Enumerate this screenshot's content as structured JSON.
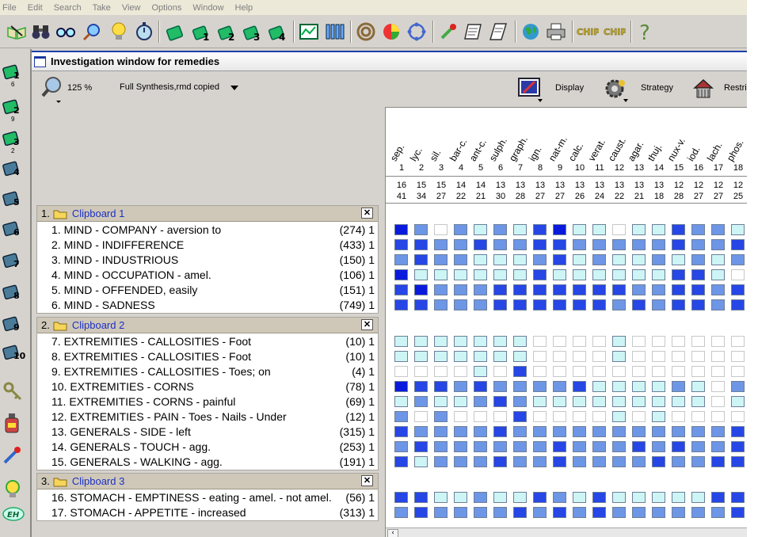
{
  "menu": [
    "File",
    "Edit",
    "Search",
    "Take",
    "View",
    "Options",
    "Window",
    "Help"
  ],
  "window_title": "Investigation window for remedies",
  "zoom": "125 %",
  "document": "Full Synthesis,rmd copied",
  "buttons": {
    "display": "Display",
    "strategy": "Strategy",
    "restrict": "Restri"
  },
  "toolbar_icons": [
    "open-book-icon",
    "binoculars-icon",
    "glasses-icon",
    "magnifier-icon",
    "lightbulb-icon",
    "stopwatch-icon",
    "clipboard-icon",
    "clipboard-1-icon",
    "clipboard-2-icon",
    "clipboard-3-icon",
    "clipboard-4-icon",
    "chart-icon",
    "test-tubes-icon",
    "target-icon",
    "pie-chart-icon",
    "cycle-icon",
    "pipette-icon",
    "scroll-icon",
    "scroll-2-icon",
    "globe-icon",
    "printer-icon",
    "chip-icon",
    "chip-2-icon",
    "help-icon"
  ],
  "toolbar_text": {
    "chip1": "CHIP",
    "chip2": "CHIP",
    "help": "?"
  },
  "sidebar": [
    {
      "label": "1",
      "count": "6"
    },
    {
      "label": "2",
      "count": "9"
    },
    {
      "label": "3",
      "count": "2"
    },
    {
      "label": "4",
      "count": ""
    },
    {
      "label": "5",
      "count": ""
    },
    {
      "label": "6",
      "count": ""
    },
    {
      "label": "7",
      "count": ""
    },
    {
      "label": "8",
      "count": ""
    },
    {
      "label": "9",
      "count": ""
    },
    {
      "label": "10",
      "count": ""
    },
    {
      "label": "",
      "count": ""
    },
    {
      "label": "",
      "count": ""
    },
    {
      "label": "",
      "count": ""
    },
    {
      "label": "",
      "count": ""
    },
    {
      "label": "EH",
      "count": ""
    }
  ],
  "clipboards": [
    {
      "num": "1.",
      "name": "Clipboard 1",
      "rubrics": [
        {
          "text": "1. MIND - COMPANY - aversion to",
          "count": "(274) 1"
        },
        {
          "text": "2. MIND - INDIFFERENCE",
          "count": "(433) 1"
        },
        {
          "text": "3. MIND - INDUSTRIOUS",
          "count": "(150) 1"
        },
        {
          "text": "4. MIND - OCCUPATION - amel.",
          "count": "(106) 1"
        },
        {
          "text": "5. MIND - OFFENDED, easily",
          "count": "(151) 1"
        },
        {
          "text": "6. MIND - SADNESS",
          "count": "(749) 1"
        }
      ]
    },
    {
      "num": "2.",
      "name": "Clipboard 2",
      "rubrics": [
        {
          "text": "7. EXTREMITIES - CALLOSITIES - Foot",
          "count": "(10) 1"
        },
        {
          "text": "8. EXTREMITIES - CALLOSITIES - Foot",
          "count": "(10) 1"
        },
        {
          "text": "9. EXTREMITIES - CALLOSITIES - Toes; on",
          "count": "(4) 1"
        },
        {
          "text": "10. EXTREMITIES - CORNS",
          "count": "(78) 1"
        },
        {
          "text": "11. EXTREMITIES - CORNS - painful",
          "count": "(69) 1"
        },
        {
          "text": "12. EXTREMITIES - PAIN - Toes - Nails - Under",
          "count": "(12) 1"
        },
        {
          "text": "13. GENERALS - SIDE - left",
          "count": "(315) 1"
        },
        {
          "text": "14. GENERALS - TOUCH - agg.",
          "count": "(253) 1"
        },
        {
          "text": "15. GENERALS - WALKING - agg.",
          "count": "(191) 1"
        }
      ]
    },
    {
      "num": "3.",
      "name": "Clipboard 3",
      "rubrics": [
        {
          "text": "16. STOMACH - EMPTINESS - eating - amel. - not amel.",
          "count": "(56) 1"
        },
        {
          "text": "17. STOMACH - APPETITE - increased",
          "count": "(313) 1"
        }
      ]
    }
  ],
  "remedies": [
    {
      "name": "sep.",
      "rank": "1",
      "sum": "16",
      "deg": "41"
    },
    {
      "name": "lyc.",
      "rank": "2",
      "sum": "15",
      "deg": "34"
    },
    {
      "name": "sil.",
      "rank": "3",
      "sum": "15",
      "deg": "27"
    },
    {
      "name": "bar-c.",
      "rank": "4",
      "sum": "14",
      "deg": "22"
    },
    {
      "name": "ant-c.",
      "rank": "5",
      "sum": "14",
      "deg": "21"
    },
    {
      "name": "sulph.",
      "rank": "6",
      "sum": "13",
      "deg": "30"
    },
    {
      "name": "graph.",
      "rank": "7",
      "sum": "13",
      "deg": "28"
    },
    {
      "name": "ign.",
      "rank": "8",
      "sum": "13",
      "deg": "27"
    },
    {
      "name": "nat-m.",
      "rank": "9",
      "sum": "13",
      "deg": "27"
    },
    {
      "name": "calc.",
      "rank": "10",
      "sum": "13",
      "deg": "26"
    },
    {
      "name": "verat.",
      "rank": "11",
      "sum": "13",
      "deg": "24"
    },
    {
      "name": "caust.",
      "rank": "12",
      "sum": "13",
      "deg": "22"
    },
    {
      "name": "agar.",
      "rank": "13",
      "sum": "13",
      "deg": "21"
    },
    {
      "name": "thuj.",
      "rank": "14",
      "sum": "13",
      "deg": "18"
    },
    {
      "name": "nux-v.",
      "rank": "15",
      "sum": "12",
      "deg": "28"
    },
    {
      "name": "iod.",
      "rank": "16",
      "sum": "12",
      "deg": "27"
    },
    {
      "name": "lach.",
      "rank": "17",
      "sum": "12",
      "deg": "27"
    },
    {
      "name": "phos.",
      "rank": "18",
      "sum": "12",
      "deg": "25"
    }
  ],
  "grade_colors": [
    "#ffffff",
    "#cdf5f5",
    "#6e96e6",
    "#2646e6",
    "#0a1adc"
  ],
  "grid_rows": [
    [
      4,
      2,
      0,
      2,
      1,
      2,
      1,
      3,
      4,
      1,
      1,
      0,
      1,
      1,
      3,
      2,
      2,
      1
    ],
    [
      3,
      3,
      2,
      2,
      3,
      2,
      2,
      3,
      3,
      2,
      2,
      2,
      2,
      2,
      3,
      2,
      2,
      3
    ],
    [
      2,
      3,
      2,
      2,
      1,
      1,
      1,
      2,
      3,
      1,
      2,
      1,
      1,
      2,
      1,
      2,
      1,
      2
    ],
    [
      4,
      1,
      1,
      1,
      1,
      1,
      1,
      3,
      1,
      1,
      1,
      1,
      1,
      1,
      3,
      3,
      1,
      0
    ],
    [
      3,
      4,
      2,
      2,
      2,
      3,
      3,
      3,
      3,
      3,
      3,
      3,
      2,
      2,
      3,
      3,
      2,
      3
    ],
    [
      3,
      3,
      2,
      2,
      2,
      3,
      3,
      3,
      3,
      3,
      3,
      2,
      3,
      2,
      3,
      3,
      2,
      3
    ],
    [
      1,
      1,
      1,
      1,
      1,
      1,
      1,
      0,
      0,
      0,
      0,
      1,
      0,
      0,
      0,
      0,
      0,
      0
    ],
    [
      1,
      1,
      1,
      1,
      1,
      1,
      1,
      0,
      0,
      0,
      0,
      1,
      0,
      0,
      0,
      0,
      0,
      0
    ],
    [
      0,
      0,
      0,
      0,
      1,
      0,
      3,
      0,
      0,
      0,
      0,
      0,
      0,
      0,
      0,
      0,
      0,
      0
    ],
    [
      4,
      3,
      3,
      2,
      3,
      2,
      2,
      2,
      2,
      3,
      1,
      1,
      1,
      1,
      2,
      1,
      0,
      2
    ],
    [
      1,
      2,
      1,
      1,
      2,
      3,
      2,
      1,
      1,
      1,
      1,
      1,
      1,
      1,
      1,
      1,
      0,
      1
    ],
    [
      2,
      0,
      2,
      0,
      0,
      0,
      3,
      0,
      0,
      0,
      0,
      1,
      0,
      1,
      0,
      0,
      0,
      0
    ],
    [
      3,
      2,
      2,
      2,
      2,
      3,
      2,
      2,
      2,
      2,
      2,
      2,
      2,
      2,
      2,
      2,
      2,
      3
    ],
    [
      2,
      3,
      2,
      2,
      2,
      2,
      2,
      2,
      3,
      2,
      2,
      2,
      3,
      2,
      3,
      2,
      2,
      3
    ],
    [
      3,
      1,
      2,
      2,
      2,
      3,
      2,
      2,
      3,
      2,
      2,
      2,
      2,
      3,
      2,
      2,
      3,
      3
    ],
    [
      3,
      3,
      1,
      1,
      2,
      1,
      1,
      3,
      2,
      1,
      3,
      1,
      1,
      1,
      1,
      1,
      3,
      3
    ],
    [
      2,
      3,
      2,
      2,
      2,
      2,
      3,
      2,
      3,
      2,
      3,
      2,
      2,
      2,
      2,
      2,
      2,
      3
    ]
  ]
}
